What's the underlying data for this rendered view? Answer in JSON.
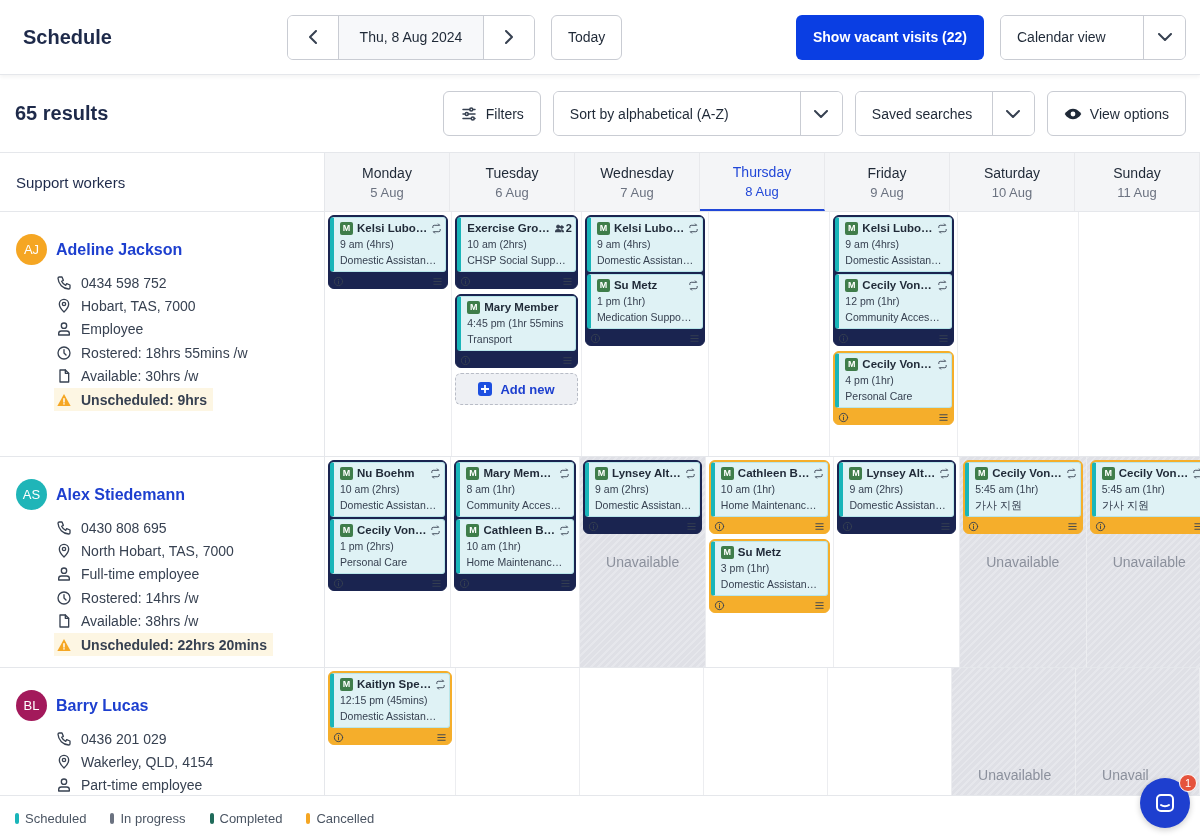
{
  "header": {
    "title": "Schedule",
    "date": "Thu, 8 Aug 2024",
    "today_button": "Today",
    "vacant_button": "Show vacant visits (22)",
    "view_select": "Calendar view"
  },
  "toolbar": {
    "results": "65 results",
    "filters_button": "Filters",
    "sort_select": "Sort by alphabetical (A-Z)",
    "saved_select": "Saved searches",
    "view_options_button": "View options"
  },
  "grid": {
    "workers_heading": "Support workers",
    "days": [
      {
        "day": "Monday",
        "date": "5 Aug",
        "selected": false
      },
      {
        "day": "Tuesday",
        "date": "6 Aug",
        "selected": false
      },
      {
        "day": "Wednesday",
        "date": "7 Aug",
        "selected": false
      },
      {
        "day": "Thursday",
        "date": "8 Aug",
        "selected": true
      },
      {
        "day": "Friday",
        "date": "9 Aug",
        "selected": false
      },
      {
        "day": "Saturday",
        "date": "10 Aug",
        "selected": false
      },
      {
        "day": "Sunday",
        "date": "11 Aug",
        "selected": false
      }
    ],
    "workers": [
      {
        "name": "Adeline Jackson",
        "initials": "AJ",
        "color": "#f5a623",
        "details": [
          {
            "kind": "phone",
            "text": "0434 598 752"
          },
          {
            "kind": "location",
            "text": "Hobart, TAS, 7000"
          },
          {
            "kind": "person",
            "text": "Employee"
          },
          {
            "kind": "clock",
            "text": "Rostered: 18hrs 55mins /w"
          },
          {
            "kind": "file",
            "text": "Available: 30hrs /w"
          },
          {
            "kind": "warning",
            "text": "Unscheduled: 9hrs"
          }
        ],
        "cells": [
          {
            "unavailable": false,
            "groups": [
              {
                "cancelled": false,
                "shifts": [
                  {
                    "badge": "M",
                    "client": "Kelsi Lubo…",
                    "recurring": true,
                    "time": "9 am (4hrs)",
                    "service": "Domestic Assistan…"
                  }
                ]
              }
            ]
          },
          {
            "unavailable": false,
            "add_new": "Add new",
            "groups": [
              {
                "cancelled": false,
                "shifts": [
                  {
                    "client": "Exercise Gro…",
                    "attendees": "2",
                    "recurring": false,
                    "time": "10 am (2hrs)",
                    "service": "CHSP Social Supp…"
                  }
                ]
              },
              {
                "cancelled": false,
                "shifts": [
                  {
                    "badge": "M",
                    "client": "Mary Member",
                    "recurring": false,
                    "time": "4:45 pm (1hr 55mins",
                    "service": "Transport"
                  }
                ]
              }
            ]
          },
          {
            "unavailable": false,
            "groups": [
              {
                "cancelled": false,
                "shifts": [
                  {
                    "badge": "M",
                    "client": "Kelsi Lubo…",
                    "recurring": true,
                    "time": "9 am (4hrs)",
                    "service": "Domestic Assistan…"
                  },
                  {
                    "badge": "M",
                    "client": "Su Metz",
                    "recurring": true,
                    "time": "1 pm (1hr)",
                    "service": "Medication Suppo…"
                  }
                ]
              }
            ]
          },
          {
            "unavailable": false
          },
          {
            "unavailable": false,
            "groups": [
              {
                "cancelled": false,
                "shifts": [
                  {
                    "badge": "M",
                    "client": "Kelsi Lubo…",
                    "recurring": true,
                    "time": "9 am (4hrs)",
                    "service": "Domestic Assistan…"
                  },
                  {
                    "badge": "M",
                    "client": "Cecily Von…",
                    "recurring": true,
                    "time": "12 pm (1hr)",
                    "service": "Community Acces…"
                  }
                ]
              },
              {
                "cancelled": true,
                "shifts": [
                  {
                    "badge": "M",
                    "client": "Cecily Von…",
                    "recurring": true,
                    "time": "4 pm (1hr)",
                    "service": "Personal Care"
                  }
                ]
              }
            ]
          },
          {
            "unavailable": false
          },
          {
            "unavailable": false
          }
        ]
      },
      {
        "name": "Alex Stiedemann",
        "initials": "AS",
        "color": "#1fb5b8",
        "details": [
          {
            "kind": "phone",
            "text": "0430 808 695"
          },
          {
            "kind": "location",
            "text": "North Hobart, TAS, 7000"
          },
          {
            "kind": "person",
            "text": "Full-time employee"
          },
          {
            "kind": "clock",
            "text": "Rostered: 14hrs /w"
          },
          {
            "kind": "file",
            "text": "Available: 38hrs /w"
          },
          {
            "kind": "warning",
            "text": "Unscheduled: 22hrs 20mins"
          }
        ],
        "cells": [
          {
            "unavailable": false,
            "groups": [
              {
                "cancelled": false,
                "shifts": [
                  {
                    "badge": "M",
                    "client": "Nu Boehm",
                    "recurring": true,
                    "time": "10 am (2hrs)",
                    "service": "Domestic Assistan…"
                  },
                  {
                    "badge": "M",
                    "client": "Cecily Von…",
                    "recurring": true,
                    "time": "1 pm (2hrs)",
                    "service": "Personal Care"
                  }
                ]
              }
            ]
          },
          {
            "unavailable": false,
            "groups": [
              {
                "cancelled": false,
                "shifts": [
                  {
                    "badge": "M",
                    "client": "Mary Mem…",
                    "recurring": true,
                    "time": "8 am (1hr)",
                    "service": "Community Acces…"
                  },
                  {
                    "badge": "M",
                    "client": "Cathleen B…",
                    "recurring": true,
                    "time": "10 am (1hr)",
                    "service": "Home Maintenanc…"
                  }
                ]
              }
            ]
          },
          {
            "unavailable": true,
            "label": "Unavailable",
            "groups": [
              {
                "cancelled": false,
                "shifts": [
                  {
                    "badge": "M",
                    "client": "Lynsey Alt…",
                    "recurring": true,
                    "time": "9 am (2hrs)",
                    "service": "Domestic Assistan…"
                  }
                ]
              }
            ]
          },
          {
            "unavailable": false,
            "groups": [
              {
                "cancelled": true,
                "shifts": [
                  {
                    "badge": "M",
                    "client": "Cathleen B…",
                    "recurring": true,
                    "time": "10 am (1hr)",
                    "service": "Home Maintenanc…"
                  }
                ]
              },
              {
                "cancelled": true,
                "shifts": [
                  {
                    "badge": "M",
                    "client": "Su Metz",
                    "recurring": false,
                    "time": "3 pm (1hr)",
                    "service": "Domestic Assistan…"
                  }
                ]
              }
            ]
          },
          {
            "unavailable": false,
            "groups": [
              {
                "cancelled": false,
                "shifts": [
                  {
                    "badge": "M",
                    "client": "Lynsey Alt…",
                    "recurring": true,
                    "time": "9 am (2hrs)",
                    "service": "Domestic Assistan…"
                  }
                ]
              }
            ]
          },
          {
            "unavailable": true,
            "label": "Unavailable",
            "groups": [
              {
                "cancelled": true,
                "shifts": [
                  {
                    "badge": "M",
                    "client": "Cecily Von…",
                    "recurring": true,
                    "time": "5:45 am (1hr)",
                    "service": "가사 지원"
                  }
                ]
              }
            ]
          },
          {
            "unavailable": true,
            "label": "Unavailable",
            "groups": [
              {
                "cancelled": true,
                "shifts": [
                  {
                    "badge": "M",
                    "client": "Cecily Von…",
                    "recurring": true,
                    "time": "5:45 am (1hr)",
                    "service": "가사 지원"
                  }
                ]
              }
            ]
          }
        ]
      },
      {
        "name": "Barry Lucas",
        "initials": "BL",
        "color": "#a3195b",
        "details": [
          {
            "kind": "phone",
            "text": "0436 201 029"
          },
          {
            "kind": "location",
            "text": "Wakerley, QLD, 4154"
          },
          {
            "kind": "person",
            "text": "Part-time employee"
          }
        ],
        "cells": [
          {
            "unavailable": false,
            "groups": [
              {
                "cancelled": true,
                "shifts": [
                  {
                    "badge": "M",
                    "client": "Kaitlyn Spe…",
                    "recurring": true,
                    "time": "12:15 pm (45mins)",
                    "service": "Domestic Assistan…"
                  }
                ]
              }
            ]
          },
          {
            "unavailable": false
          },
          {
            "unavailable": false
          },
          {
            "unavailable": false
          },
          {
            "unavailable": false
          },
          {
            "unavailable": true,
            "label": "Unavailable"
          },
          {
            "unavailable": true,
            "label": "Unavail"
          }
        ]
      }
    ]
  },
  "legend": [
    {
      "label": "Scheduled",
      "color": "#19b5b9"
    },
    {
      "label": "In progress",
      "color": "#6b7280"
    },
    {
      "label": "Completed",
      "color": "#1f6b5a"
    },
    {
      "label": "Cancelled",
      "color": "#f5a623"
    }
  ],
  "chat": {
    "badge": "1"
  }
}
